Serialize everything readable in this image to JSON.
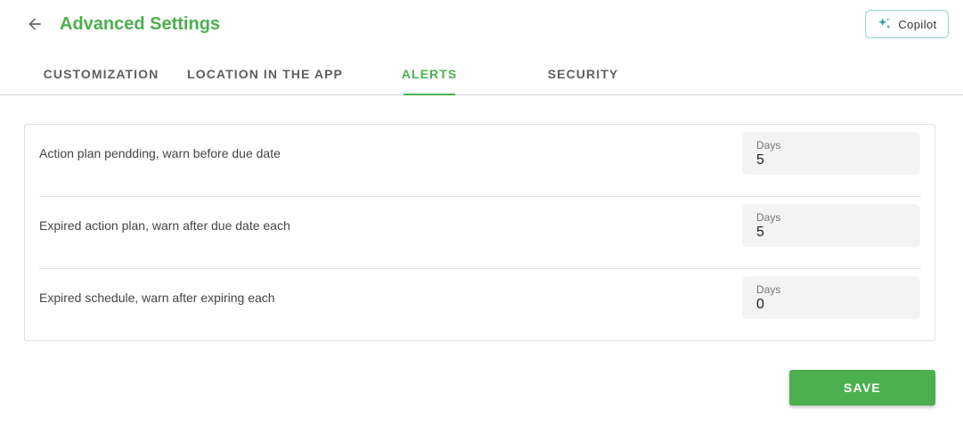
{
  "header": {
    "title": "Advanced Settings",
    "back_icon": "arrow-left-icon",
    "copilot_label": "Copilot",
    "copilot_icon": "sparkle-icon"
  },
  "tabs": [
    {
      "label": "CUSTOMIZATION",
      "active": false
    },
    {
      "label": "LOCATION IN THE APP",
      "active": false
    },
    {
      "label": "ALERTS",
      "active": true
    },
    {
      "label": "SECURITY",
      "active": false
    }
  ],
  "alerts": [
    {
      "label": "Action plan pendding, warn before due date",
      "field_label": "Days",
      "value": "5"
    },
    {
      "label": "Expired action plan, warn after due date each",
      "field_label": "Days",
      "value": "5"
    },
    {
      "label": "Expired schedule, warn after expiring each",
      "field_label": "Days",
      "value": "0"
    }
  ],
  "actions": {
    "save_label": "SAVE"
  },
  "colors": {
    "accent": "#4caf50",
    "copilot_border": "#9ccfd6",
    "copilot_icon": "#26a69a"
  }
}
